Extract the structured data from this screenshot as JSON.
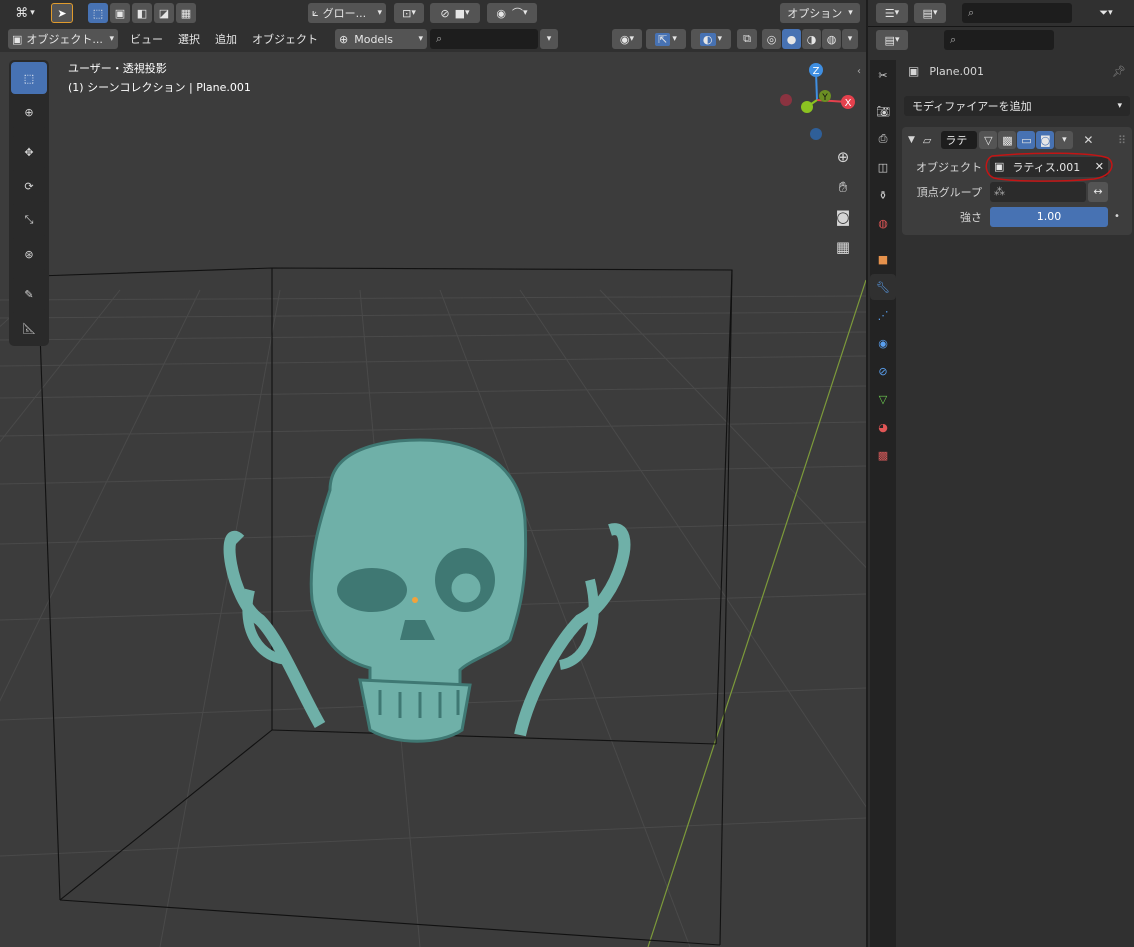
{
  "viewport": {
    "header1": {
      "transform_orientation": "グロー...",
      "options": "オプション"
    },
    "header2": {
      "mode": "オブジェクト...",
      "menus": [
        "ビュー",
        "選択",
        "追加",
        "オブジェクト"
      ],
      "collection": "Models",
      "search_placeholder": ""
    },
    "overlay": {
      "view_name": "ユーザー・透視投影",
      "collection_info": "(1) シーンコレクション | Plane.001"
    },
    "gizmo": {
      "z": "Z",
      "y": "Y",
      "x": "X"
    },
    "colors": {
      "x": "#e5414d",
      "y": "#8bc221",
      "z": "#3f8fe2",
      "object": "#6fb0a8"
    }
  },
  "properties": {
    "object_name": "Plane.001",
    "add_modifier": "モディファイアーを追加",
    "modifier": {
      "name": "ラテ",
      "object_label": "オブジェクト",
      "object_value": "ラティス.001",
      "vertex_group_label": "頂点グループ",
      "vertex_group_value": "",
      "strength_label": "強さ",
      "strength_value": "1.00"
    }
  }
}
